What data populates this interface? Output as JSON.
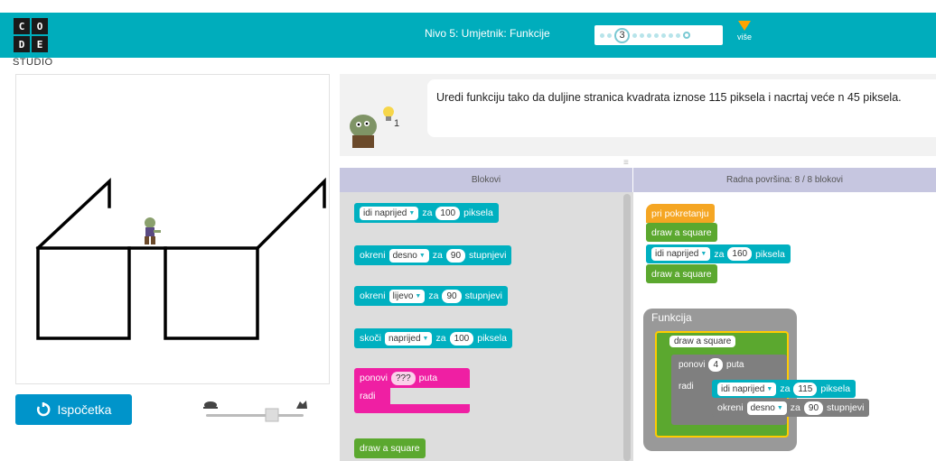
{
  "header": {
    "logo_letters": [
      "C",
      "O",
      "D",
      "E"
    ],
    "logo_sub": "STUDIO",
    "level_title": "Nivo 5: Umjetnik: Funkcije",
    "current_level": "3",
    "more_label": "više"
  },
  "instructions": {
    "text": "Uredi funkciju tako da duljine stranica kvadrata iznose 115 piksela i nacrtaj veće n 45 piksela."
  },
  "controls": {
    "reset_label": "Ispočetka"
  },
  "toolbox": {
    "header": "Blokovi",
    "blocks": [
      {
        "kind": "move",
        "dir": "idi naprijed",
        "mid": "za",
        "value": "100",
        "unit": "piksela"
      },
      {
        "kind": "turn",
        "pre": "okreni",
        "dir": "desno",
        "mid": "za",
        "value": "90",
        "unit": "stupnjevi"
      },
      {
        "kind": "turn",
        "pre": "okreni",
        "dir": "lijevo",
        "mid": "za",
        "value": "90",
        "unit": "stupnjevi"
      },
      {
        "kind": "jump",
        "pre": "skoči",
        "dir": "naprijed",
        "mid": "za",
        "value": "100",
        "unit": "piksela"
      },
      {
        "kind": "repeat",
        "pre": "ponovi",
        "value": "???",
        "unit": "puta",
        "body": "radi"
      },
      {
        "kind": "call",
        "label": "draw a square"
      }
    ]
  },
  "workspace": {
    "header": "Radna površina: 8 / 8 blokovi",
    "program": {
      "hat": "pri pokretanju",
      "call1": "draw a square",
      "move_dir": "idi naprijed",
      "move_mid": "za",
      "move_value": "160",
      "move_unit": "piksela",
      "call2": "draw a square"
    },
    "function": {
      "title": "Funkcija",
      "name": "draw a square",
      "repeat_pre": "ponovi",
      "repeat_value": "4",
      "repeat_unit": "puta",
      "repeat_body": "radi",
      "move_dir": "idi naprijed",
      "move_mid": "za",
      "move_value": "115",
      "move_unit": "piksela",
      "turn_pre": "okreni",
      "turn_dir": "desno",
      "turn_mid": "za",
      "turn_value": "90",
      "turn_unit": "stupnjevi"
    }
  },
  "colors": {
    "header_bg": "#00adbc",
    "move_block": "#00b0c0",
    "procedure_block": "#5ba82f",
    "event_block": "#f5a623",
    "loop_block": "#ef1fa3",
    "reset_button": "#0094ca"
  },
  "icons": [
    "zombie-artist-icon",
    "lightbulb-hint-icon",
    "reset-icon",
    "turtle-slow-icon",
    "rabbit-fast-icon",
    "more-arrow-icon"
  ]
}
